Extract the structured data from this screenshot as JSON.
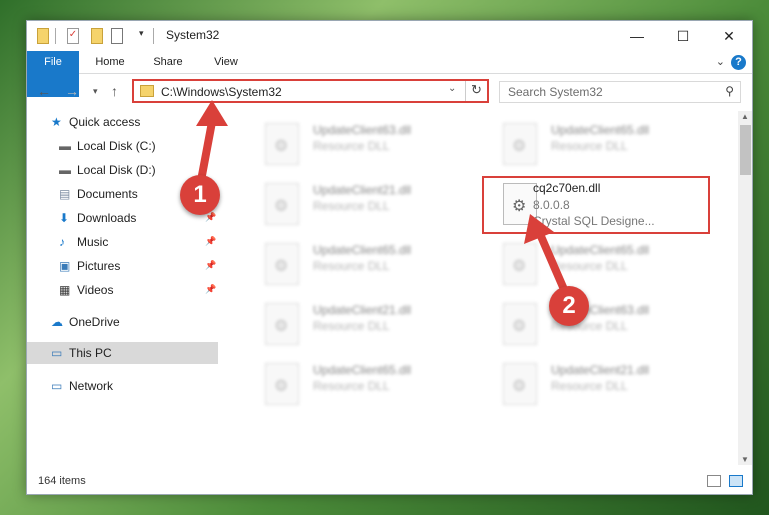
{
  "window": {
    "title": "System32"
  },
  "ribbon": {
    "tabs": [
      "File",
      "Home",
      "Share",
      "View"
    ],
    "help": "?"
  },
  "address": {
    "path": "C:\\Windows\\System32"
  },
  "search": {
    "placeholder": "Search System32"
  },
  "sidebar": {
    "items": [
      {
        "label": "Quick access",
        "icon": "star-icon"
      },
      {
        "label": "Local Disk (C:)",
        "icon": "drive-icon"
      },
      {
        "label": "Local Disk (D:)",
        "icon": "drive-icon"
      },
      {
        "label": "Documents",
        "icon": "documents-icon"
      },
      {
        "label": "Downloads",
        "icon": "download-arrow-icon"
      },
      {
        "label": "Music",
        "icon": "music-note-icon"
      },
      {
        "label": "Pictures",
        "icon": "pictures-icon"
      },
      {
        "label": "Videos",
        "icon": "film-icon"
      },
      {
        "label": "OneDrive",
        "icon": "cloud-icon"
      },
      {
        "label": "This PC",
        "icon": "monitor-icon"
      },
      {
        "label": "Network",
        "icon": "network-icon"
      }
    ]
  },
  "files": {
    "left": [
      {
        "name": "UpdateClient63.dll",
        "desc": "Resource DLL"
      },
      {
        "name": "UpdateClient21.dll",
        "desc": "Resource DLL"
      },
      {
        "name": "UpdateClient65.dll",
        "desc": "Resource DLL"
      },
      {
        "name": "UpdateClient21.dll",
        "desc": "Resource DLL"
      },
      {
        "name": "UpdateClient65.dll",
        "desc": "Resource DLL"
      }
    ],
    "right": [
      {
        "name": "UpdateClient65.dll",
        "desc": "Resource DLL"
      },
      {
        "name": "UpdateClient65.dll",
        "desc": "Resource DLL"
      },
      {
        "name": "UpdateClient63.dll",
        "desc": "Resource DLL"
      },
      {
        "name": "UpdateClient21.dll",
        "desc": "Resource DLL"
      }
    ],
    "selected": {
      "name": "cq2c70en.dll",
      "version": "8.0.0.8",
      "company": "Crystal SQL Designe..."
    }
  },
  "status": {
    "count": "164 items"
  },
  "annotations": {
    "step1": "1",
    "step2": "2",
    "color": "#d9403a"
  }
}
